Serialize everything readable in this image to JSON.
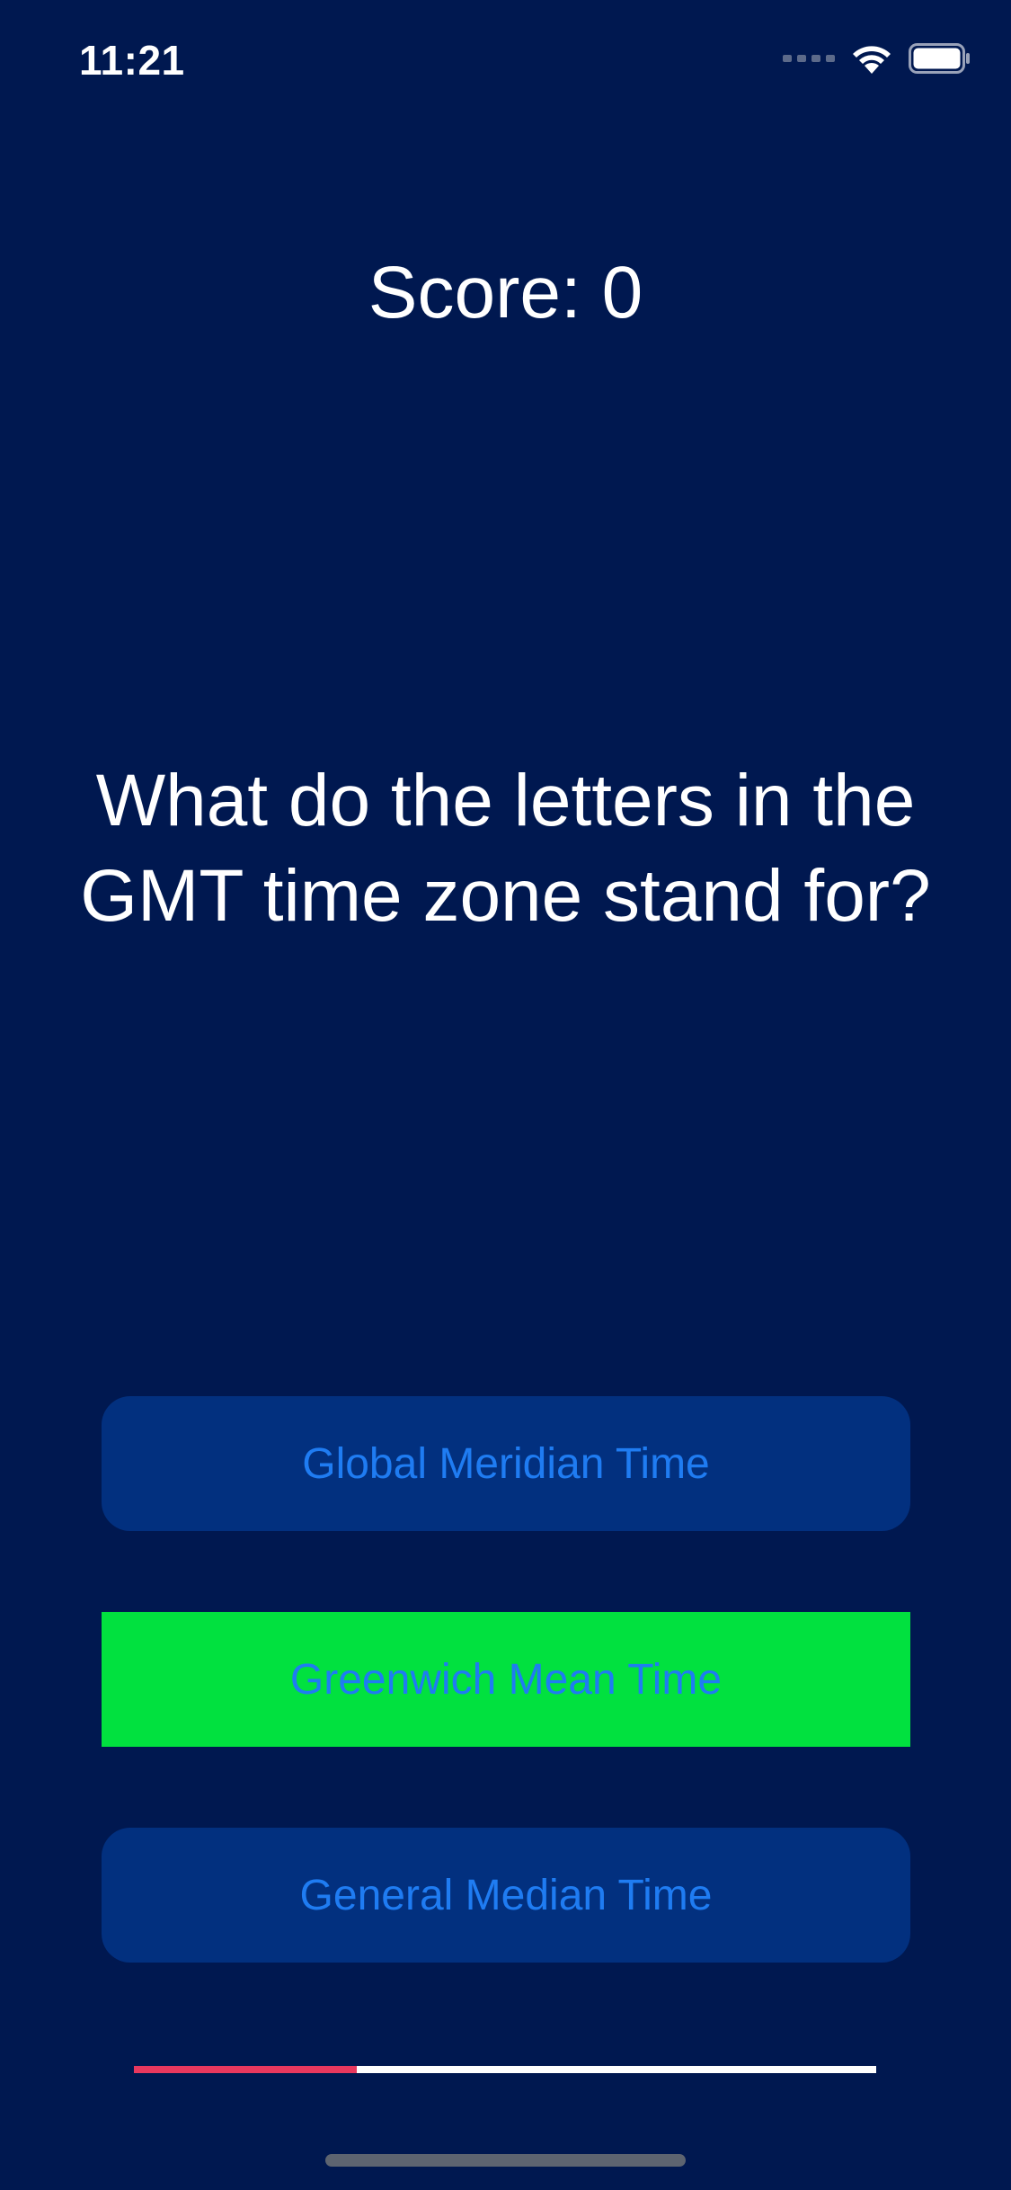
{
  "status_bar": {
    "time": "11:21",
    "icons": [
      "cellular-signal-icon",
      "wifi-icon",
      "battery-icon"
    ]
  },
  "quiz": {
    "score_text": "Score: 0",
    "question": "What do the letters in the GMT time zone stand for?",
    "answers": [
      {
        "label": "Global Meridian Time",
        "selected": false
      },
      {
        "label": "Greenwich Mean Time",
        "selected": true
      },
      {
        "label": "General Median Time",
        "selected": false
      }
    ],
    "progress": 0.3
  },
  "colors": {
    "background": "#001850",
    "answer_background": "#02307f",
    "answer_text": "#1f7cf2",
    "selected_correct": "#01e13f",
    "progress_fill": "#e8385e",
    "progress_track": "#ffffff"
  }
}
